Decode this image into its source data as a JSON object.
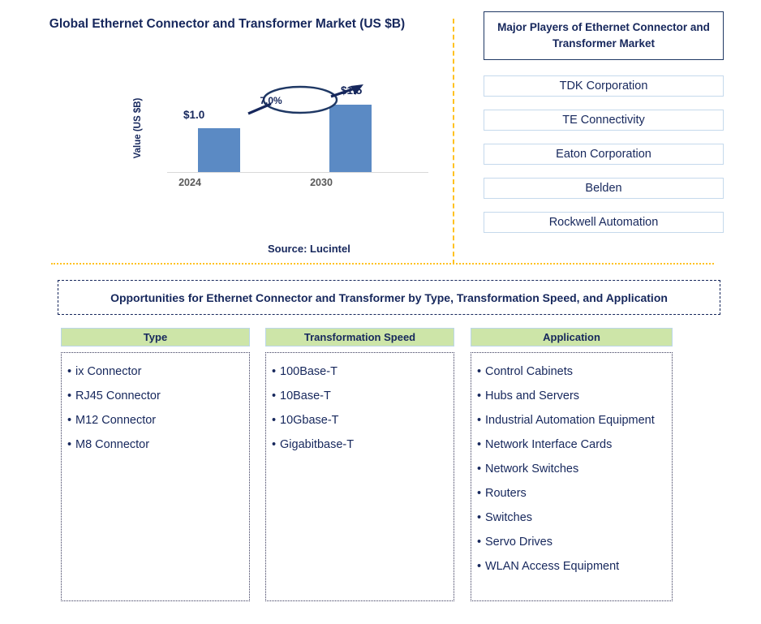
{
  "chart_panel": {
    "title": "Global Ethernet Connector and Transformer Market (US $B)",
    "y_axis_label": "Value (US $B)",
    "source": "Source: Lucintel"
  },
  "chart_data": {
    "type": "bar",
    "title": "Global Ethernet Connector and Transformer Market (US $B)",
    "categories": [
      "2024",
      "2030"
    ],
    "values": [
      1.0,
      1.5
    ],
    "value_labels": [
      "$1.0",
      "$1.5"
    ],
    "xlabel": "",
    "ylabel": "Value (US $B)",
    "ylim": [
      0,
      1.8
    ],
    "grid": false,
    "legend": "none",
    "bar_color": "#5B8AC4",
    "annotations": [
      {
        "text": "7.0%",
        "type": "cagr-ellipse-arrow",
        "from": "2024",
        "to": "2030"
      }
    ]
  },
  "players": {
    "header": "Major Players of Ethernet Connector and Transformer Market",
    "items": [
      "TDK Corporation",
      "TE Connectivity",
      "Eaton Corporation",
      "Belden",
      "Rockwell Automation"
    ]
  },
  "opportunities": {
    "banner": "Opportunities for Ethernet Connector and Transformer by Type, Transformation Speed, and Application",
    "columns": [
      {
        "header": "Type",
        "items": [
          "ix Connector",
          "RJ45 Connector",
          "M12 Connector",
          "M8 Connector"
        ]
      },
      {
        "header": "Transformation Speed",
        "items": [
          "100Base-T",
          "10Base-T",
          "10Gbase-T",
          "Gigabitbase-T"
        ]
      },
      {
        "header": "Application",
        "items": [
          "Control Cabinets",
          "Hubs and Servers",
          "Industrial Automation Equipment",
          "Network Interface Cards",
          "Network Switches",
          "Routers",
          "Switches",
          "Servo Drives",
          "WLAN Access Equipment"
        ]
      }
    ]
  },
  "colors": {
    "navy": "#16275C",
    "bar_blue": "#5B8AC4",
    "divider_gold": "#FFC222",
    "header_green": "#CDE5A8",
    "player_border": "#C5D9EC"
  }
}
